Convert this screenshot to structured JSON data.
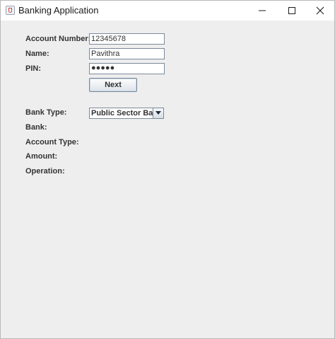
{
  "window": {
    "title": "Banking Application",
    "controls": {
      "minimize": "minimize-icon",
      "maximize": "maximize-icon",
      "close": "close-icon"
    }
  },
  "form": {
    "account_number": {
      "label": "Account Number:",
      "value": "12345678"
    },
    "name": {
      "label": "Name:",
      "value": "Pavithra"
    },
    "pin": {
      "label": "PIN:",
      "value": "●●●●●"
    },
    "next_button": "Next",
    "bank_type": {
      "label": "Bank Type:",
      "selected": "Public Sector Bank"
    },
    "bank": {
      "label": "Bank:"
    },
    "account_type": {
      "label": "Account Type:"
    },
    "amount": {
      "label": "Amount:"
    },
    "operation": {
      "label": "Operation:"
    }
  }
}
